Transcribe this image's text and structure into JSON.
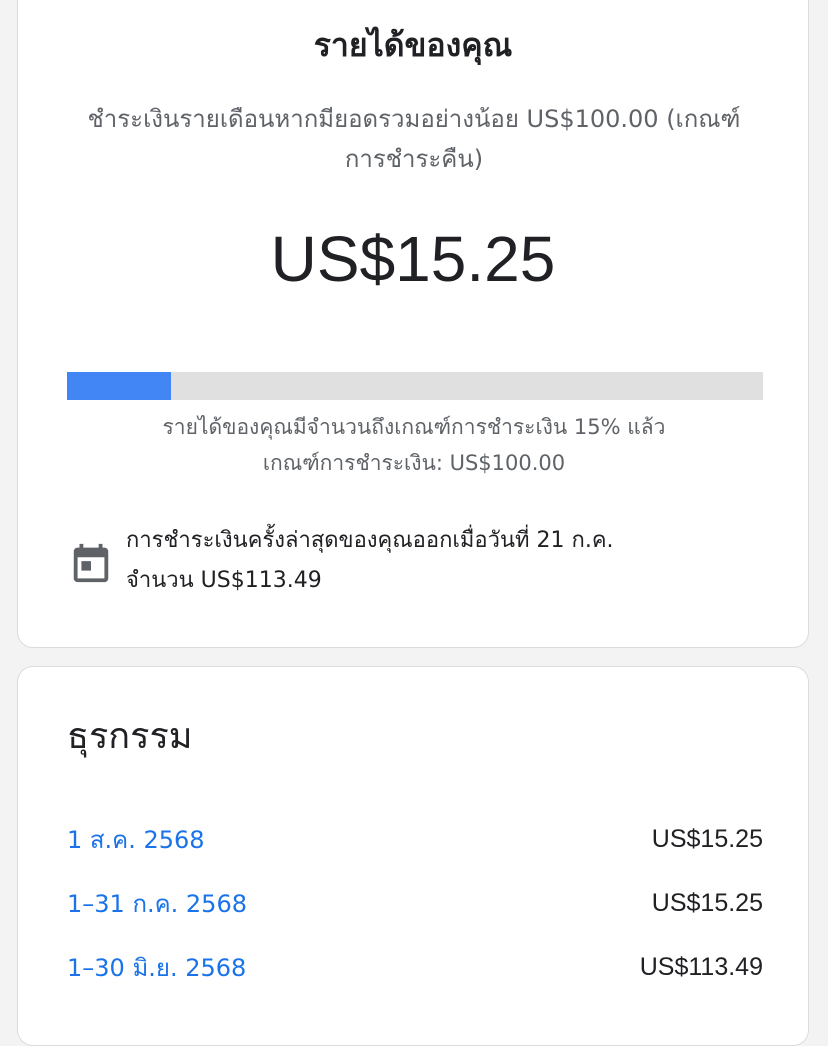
{
  "earnings": {
    "title": "รายได้ของคุณ",
    "subtitle": "ชำระเงินรายเดือนหากมียอดรวมอย่างน้อย US$100.00 (เกณฑ์การชำระคืน)",
    "amount": "US$15.25",
    "progress_fraction": 0.15,
    "progress_text": "รายได้ของคุณมีจำนวนถึงเกณฑ์การชำระเงิน 15% แล้ว",
    "threshold_text": "เกณฑ์การชำระเงิน: US$100.00",
    "last_payment_line1": "การชำระเงินครั้งล่าสุดของคุณออกเมื่อวันที่ 21 ก.ค.",
    "last_payment_line2": "จำนวน US$113.49",
    "progress_color": "#4285f4",
    "icon": "calendar-icon"
  },
  "transactions": {
    "title": "ธุรกรรม",
    "rows": [
      {
        "date": "1 ส.ค. 2568",
        "amount": "US$15.25"
      },
      {
        "date": "1–31 ก.ค. 2568",
        "amount": "US$15.25"
      },
      {
        "date": "1–30 มิ.ย. 2568",
        "amount": "US$113.49"
      }
    ],
    "link_color": "#1a73e8"
  }
}
